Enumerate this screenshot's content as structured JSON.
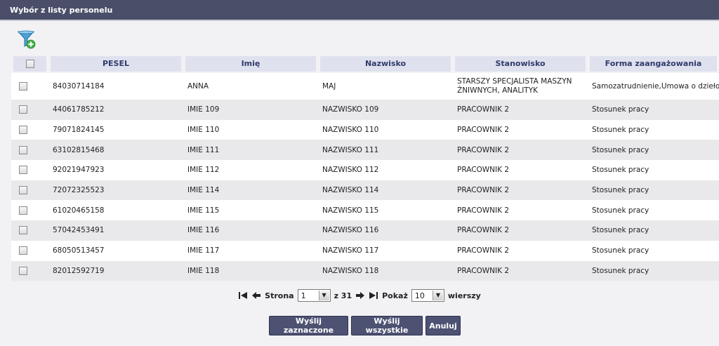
{
  "window": {
    "title": "Wybór z listy personelu"
  },
  "table": {
    "columns": [
      "PESEL",
      "Imię",
      "Nazwisko",
      "Stanowisko",
      "Forma zaangażowania"
    ],
    "rows": [
      {
        "pesel": "84030714184",
        "imie": "ANNA",
        "nazwisko": "MAJ",
        "stanowisko": "STARSZY SPECJALISTA MASZYN ŻNIWNYCH, ANALITYK",
        "forma": "Samozatrudnienie,Umowa o dzieło"
      },
      {
        "pesel": "44061785212",
        "imie": "IMIE 109",
        "nazwisko": "NAZWISKO 109",
        "stanowisko": "PRACOWNIK 2",
        "forma": "Stosunek pracy"
      },
      {
        "pesel": "79071824145",
        "imie": "IMIE 110",
        "nazwisko": "NAZWISKO 110",
        "stanowisko": "PRACOWNIK 2",
        "forma": "Stosunek pracy"
      },
      {
        "pesel": "63102815468",
        "imie": "IMIE 111",
        "nazwisko": "NAZWISKO 111",
        "stanowisko": "PRACOWNIK 2",
        "forma": "Stosunek pracy"
      },
      {
        "pesel": "92021947923",
        "imie": "IMIE 112",
        "nazwisko": "NAZWISKO 112",
        "stanowisko": "PRACOWNIK 2",
        "forma": "Stosunek pracy"
      },
      {
        "pesel": "72072325523",
        "imie": "IMIE 114",
        "nazwisko": "NAZWISKO 114",
        "stanowisko": "PRACOWNIK 2",
        "forma": "Stosunek pracy"
      },
      {
        "pesel": "61020465158",
        "imie": "IMIE 115",
        "nazwisko": "NAZWISKO 115",
        "stanowisko": "PRACOWNIK 2",
        "forma": "Stosunek pracy"
      },
      {
        "pesel": "57042453491",
        "imie": "IMIE 116",
        "nazwisko": "NAZWISKO 116",
        "stanowisko": "PRACOWNIK 2",
        "forma": "Stosunek pracy"
      },
      {
        "pesel": "68050513457",
        "imie": "IMIE 117",
        "nazwisko": "NAZWISKO 117",
        "stanowisko": "PRACOWNIK 2",
        "forma": "Stosunek pracy"
      },
      {
        "pesel": "82012592719",
        "imie": "IMIE 118",
        "nazwisko": "NAZWISKO 118",
        "stanowisko": "PRACOWNIK 2",
        "forma": "Stosunek pracy"
      }
    ]
  },
  "pager": {
    "page_label": "Strona",
    "page_value": "1",
    "of_label": "z 31",
    "show_label": "Pokaż",
    "show_value": "10",
    "rows_label": "wierszy"
  },
  "buttons": {
    "send_selected": "Wyślij zaznaczone",
    "send_all": "Wyślij wszystkie",
    "cancel": "Anuluj"
  },
  "icons": {
    "filter": "filter-add-icon",
    "first": "first-page-icon",
    "prev": "prev-page-icon",
    "next": "next-page-icon",
    "last": "last-page-icon"
  },
  "colors": {
    "titlebar": "#4a4e68",
    "header_cell": "#dfe1ee",
    "button": "#4d5272"
  }
}
